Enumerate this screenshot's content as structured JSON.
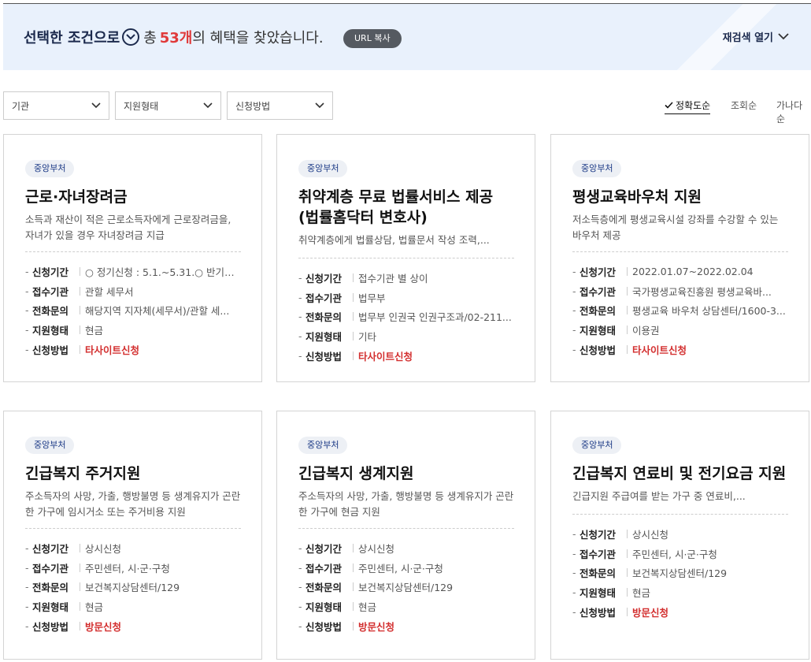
{
  "banner": {
    "lead": "선택한 조건으로",
    "mid": "총",
    "count": "53개",
    "tail": "의 혜택을 찾았습니다.",
    "url_button": "URL 복사",
    "research": "재검색 열기"
  },
  "filters": [
    {
      "label": "기관"
    },
    {
      "label": "지원형태"
    },
    {
      "label": "신청방법"
    }
  ],
  "sort": {
    "options": [
      "정확도순",
      "조회순",
      "가나다순"
    ],
    "active": "정확도순"
  },
  "colors": {
    "accent": "#1c3a86",
    "count": "#e03a3a",
    "apply": "#d32f2f"
  },
  "cards": [
    {
      "badge": "중앙부처",
      "title": "근로·자녀장려금",
      "desc": "소득과 재산이 적은 근로소득자에게 근로장려금을, 자녀가 있을 경우 자녀장려금 지급",
      "rows": [
        {
          "label": "신청기간",
          "value": "○ 정기신청 : 5.1.~5.31.○ 반기신..."
        },
        {
          "label": "접수기관",
          "value": "관할 세무서"
        },
        {
          "label": "전화문의",
          "value": "해당지역 지자체(세무서)/관할 세..."
        },
        {
          "label": "지원형태",
          "value": "현금"
        },
        {
          "label": "신청방법",
          "value": "타사이트신청"
        }
      ]
    },
    {
      "badge": "중앙부처",
      "title": "취약계층 무료 법률서비스 제공 (법률홈닥터 변호사)",
      "desc": "취약계층에게 법률상담, 법률문서 작성 조력,...",
      "rows": [
        {
          "label": "신청기간",
          "value": "접수기관 별 상이"
        },
        {
          "label": "접수기관",
          "value": "법무부"
        },
        {
          "label": "전화문의",
          "value": "법무부 인권국 인권구조과/02-211..."
        },
        {
          "label": "지원형태",
          "value": "기타"
        },
        {
          "label": "신청방법",
          "value": "타사이트신청"
        }
      ]
    },
    {
      "badge": "중앙부처",
      "title": "평생교육바우처 지원",
      "desc": "저소득층에게 평생교육시설 강좌를 수강할 수 있는 바우처 제공",
      "rows": [
        {
          "label": "신청기간",
          "value": "2022.01.07~2022.02.04"
        },
        {
          "label": "접수기관",
          "value": "국가평생교육진흥원 평생교육바..."
        },
        {
          "label": "전화문의",
          "value": "평생교육 바우처 상담센터/1600-3..."
        },
        {
          "label": "지원형태",
          "value": "이용권"
        },
        {
          "label": "신청방법",
          "value": "타사이트신청"
        }
      ]
    },
    {
      "badge": "중앙부처",
      "title": "긴급복지 주거지원",
      "desc": "주소득자의 사망, 가출, 행방불명 등 생계유지가 곤란한 가구에 임시거소 또는 주거비용 지원",
      "rows": [
        {
          "label": "신청기간",
          "value": "상시신청"
        },
        {
          "label": "접수기관",
          "value": "주민센터, 시·군·구청"
        },
        {
          "label": "전화문의",
          "value": "보건복지상담센터/129"
        },
        {
          "label": "지원형태",
          "value": "현금"
        },
        {
          "label": "신청방법",
          "value": "방문신청"
        }
      ]
    },
    {
      "badge": "중앙부처",
      "title": "긴급복지 생계지원",
      "desc": "주소득자의 사망, 가출, 행방불명 등 생계유지가 곤란한 가구에 현금 지원",
      "rows": [
        {
          "label": "신청기간",
          "value": "상시신청"
        },
        {
          "label": "접수기관",
          "value": "주민센터, 시·군·구청"
        },
        {
          "label": "전화문의",
          "value": "보건복지상담센터/129"
        },
        {
          "label": "지원형태",
          "value": "현금"
        },
        {
          "label": "신청방법",
          "value": "방문신청"
        }
      ]
    },
    {
      "badge": "중앙부처",
      "title": "긴급복지 연료비 및 전기요금 지원",
      "desc": "긴급지원 주급여를 받는 가구 중 연료비,...",
      "rows": [
        {
          "label": "신청기간",
          "value": "상시신청"
        },
        {
          "label": "접수기관",
          "value": "주민센터, 시·군·구청"
        },
        {
          "label": "전화문의",
          "value": "보건복지상담센터/129"
        },
        {
          "label": "지원형태",
          "value": "현금"
        },
        {
          "label": "신청방법",
          "value": "방문신청"
        }
      ]
    }
  ]
}
